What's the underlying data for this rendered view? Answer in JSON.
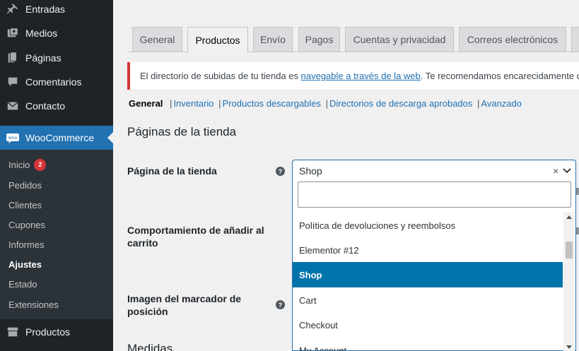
{
  "sidebar": {
    "items": [
      {
        "label": "Entradas",
        "icon": "pin-icon"
      },
      {
        "label": "Medios",
        "icon": "media-icon"
      },
      {
        "label": "Páginas",
        "icon": "pages-icon"
      },
      {
        "label": "Comentarios",
        "icon": "comments-icon"
      },
      {
        "label": "Contacto",
        "icon": "mail-icon"
      }
    ],
    "woocommerce": {
      "label": "WooCommerce",
      "icon": "woo-icon"
    },
    "submenu": [
      {
        "label": "Inicio",
        "badge": "2"
      },
      {
        "label": "Pedidos"
      },
      {
        "label": "Clientes"
      },
      {
        "label": "Cupones"
      },
      {
        "label": "Informes"
      },
      {
        "label": "Ajustes",
        "current": true
      },
      {
        "label": "Estado"
      },
      {
        "label": "Extensiones"
      }
    ],
    "productos": {
      "label": "Productos",
      "icon": "products-icon"
    }
  },
  "tabs": [
    "General",
    "Productos",
    "Envío",
    "Pagos",
    "Cuentas y privacidad",
    "Correos electrónicos"
  ],
  "active_tab": "Productos",
  "notice": {
    "before": "El directorio de subidas de tu tienda es ",
    "link": "navegable a través de la web",
    "after": ". Te recomendamos encarecidamente que"
  },
  "subsections": {
    "current": "General",
    "links": [
      "Inventario",
      "Productos descargables",
      "Directorios de descarga aprobados",
      "Avanzado"
    ],
    "separator": "|"
  },
  "section_title": "Páginas de la tienda",
  "fields": {
    "shop_page": {
      "label": "Página de la tienda",
      "value": "Shop",
      "clear": "×"
    },
    "add_to_cart": {
      "label_line1": "Comportamiento de añadir al",
      "label_line2": "carrito"
    },
    "placeholder": {
      "label_line1": "Imagen del marcador de",
      "label_line2": "posición"
    },
    "next_section": "Medidas"
  },
  "help_glyph": "?",
  "dropdown": {
    "search_value": "",
    "options": [
      {
        "label": "Política de devoluciones y reembolsos",
        "highlighted": false
      },
      {
        "label": "Elementor #12",
        "highlighted": false
      },
      {
        "label": "Shop",
        "highlighted": true
      },
      {
        "label": "Cart",
        "highlighted": false
      },
      {
        "label": "Checkout",
        "highlighted": false
      },
      {
        "label": "My Account",
        "highlighted": false
      }
    ]
  },
  "colors": {
    "accent": "#2271b1",
    "sidebar_bg": "#1d2327",
    "highlight": "#0073aa",
    "error": "#d63638"
  }
}
